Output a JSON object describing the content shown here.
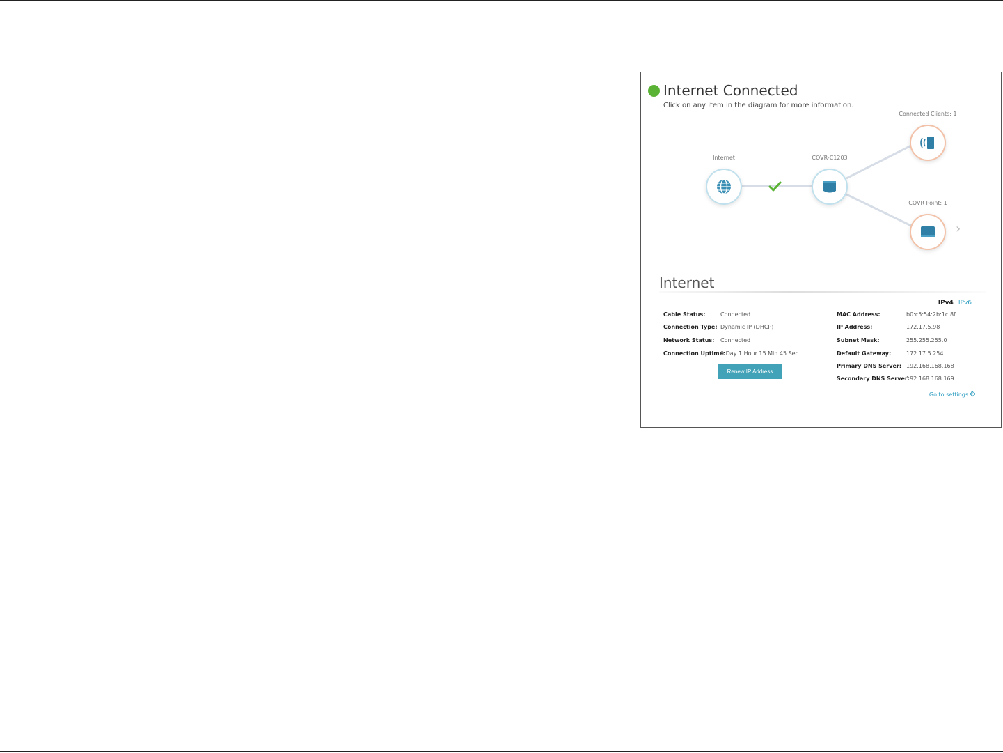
{
  "status": {
    "title": "Internet Connected",
    "subtitle": "Click on any item in the diagram for more information.",
    "dot_color": "#5bb335"
  },
  "nodes": {
    "internet_label": "Internet",
    "router_label": "COVR-C1203",
    "clients_label": "Connected Clients: 1",
    "extender_label": "COVR Point: 1"
  },
  "section": {
    "title": "Internet"
  },
  "ip_tabs": {
    "active": "IPv4",
    "separator": "|",
    "other": "IPv6"
  },
  "info_left": [
    {
      "key": "Cable Status:",
      "value": "Connected"
    },
    {
      "key": "Connection Type:",
      "value": "Dynamic IP (DHCP)"
    },
    {
      "key": "Network Status:",
      "value": "Connected"
    },
    {
      "key": "Connection Uptime:",
      "value": "0 Day 1 Hour 15 Min 45 Sec"
    }
  ],
  "info_right": [
    {
      "key": "MAC Address:",
      "value": "b0:c5:54:2b:1c:8f"
    },
    {
      "key": "IP Address:",
      "value": "172.17.5.98"
    },
    {
      "key": "Subnet Mask:",
      "value": "255.255.255.0"
    },
    {
      "key": "Default Gateway:",
      "value": "172.17.5.254"
    },
    {
      "key": "Primary DNS Server:",
      "value": "192.168.168.168"
    },
    {
      "key": "Secondary DNS Server:",
      "value": "192.168.168.169"
    }
  ],
  "renew_button": "Renew IP Address",
  "advanced_link": "Go to settings",
  "colors": {
    "accent": "#41a2b8",
    "link": "#2e9ec2",
    "check": "#5bb335"
  }
}
